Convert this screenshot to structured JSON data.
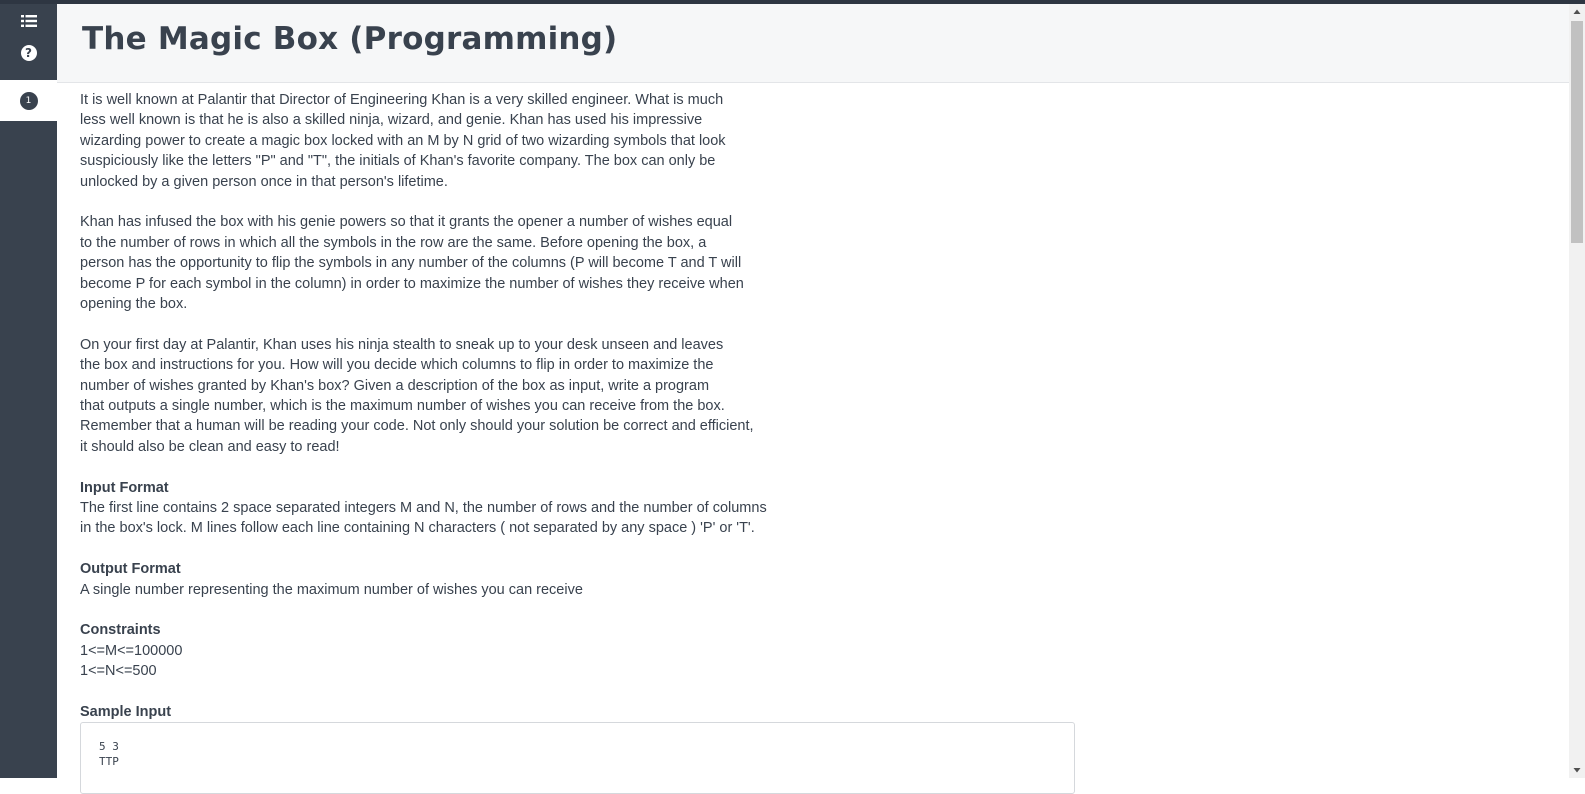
{
  "sidebar": {
    "icons": {
      "list": "list-icon",
      "help": "help-icon"
    },
    "help_glyph": "?",
    "question_number": "1"
  },
  "header": {
    "title": "The Magic Box (Programming)"
  },
  "problem": {
    "paragraphs": [
      "It is well known at Palantir that Director of Engineering Khan is a very skilled engineer.  What is much\nless well known is that he is also a skilled ninja, wizard, and genie.  Khan has used his impressive\nwizarding power to create a magic box locked with an M by N grid of two wizarding symbols that look\nsuspiciously like the letters \"P\" and \"T\", the initials of Khan's favorite company.  The box can only be\nunlocked by a given person once in that person's lifetime.",
      "Khan has infused the box with his genie powers so that it grants the opener a number of wishes equal\nto the number of rows in which all the symbols in the row are the same.  Before opening the box, a\nperson has the opportunity to flip the symbols in any number of the columns (P will become T and T will\nbecome P for each symbol in the column) in order to maximize the number of wishes they receive when\nopening the box.",
      "On your first day at Palantir, Khan uses his ninja stealth to sneak up to your desk unseen and leaves\nthe box and instructions for you.  How will you decide which columns to flip in order to maximize the\nnumber of wishes granted by Khan's box?  Given a description of the box as input, write a program\nthat outputs a single number, which is the maximum number of wishes you can receive from the box.\nRemember that a human will be reading your code.  Not only should your solution be correct and efficient,\nit should also be clean and easy to read!"
    ],
    "input_format": {
      "title": "Input Format",
      "body": "The first line contains 2 space separated integers M and N, the number of rows and the number of columns\nin the box's lock. M lines follow each line containing N characters ( not separated by any space ) 'P' or 'T'."
    },
    "output_format": {
      "title": "Output Format",
      "body": "A single number representing the maximum number of wishes you can receive"
    },
    "constraints": {
      "title": "Constraints",
      "body": "1<=M<=100000\n1<=N<=500"
    },
    "sample_input": {
      "title": "Sample Input",
      "body": "5 3\nTTP"
    }
  },
  "scrollbar": {
    "position_fraction": 0.0
  }
}
